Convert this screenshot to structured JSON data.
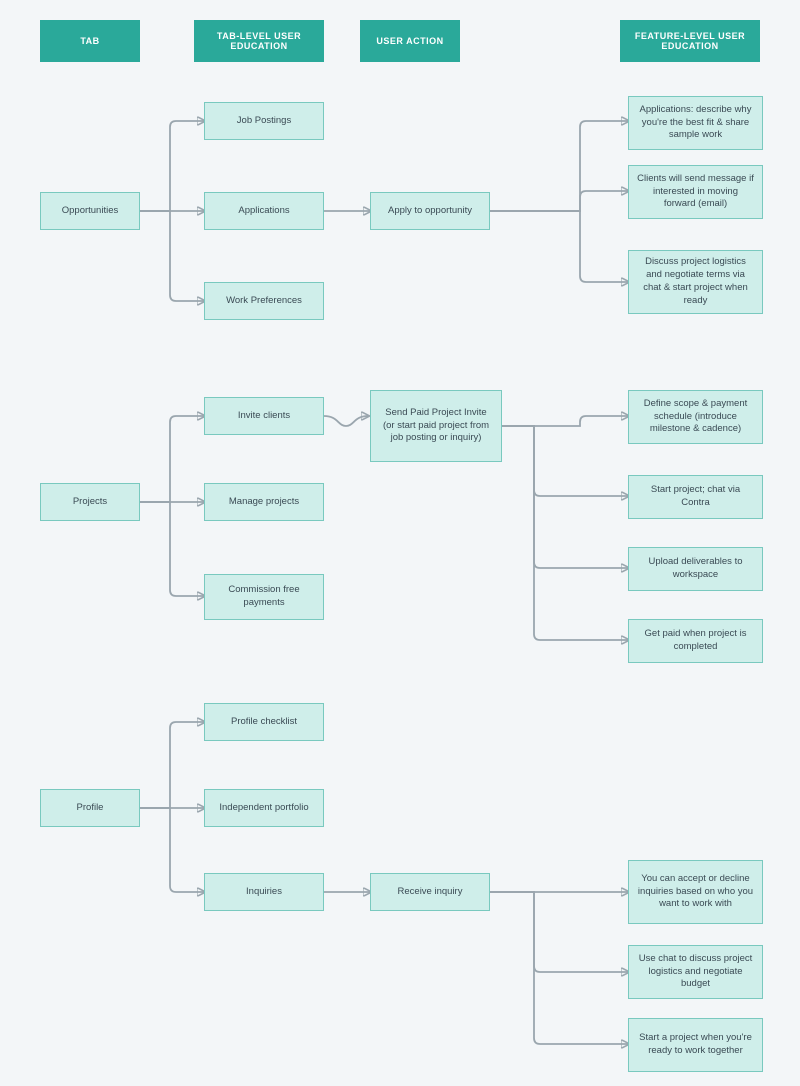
{
  "columns": {
    "tab": "TAB",
    "tabLevel": "TAB-LEVEL USER EDUCATION",
    "userAction": "USER ACTION",
    "featureLevel": "FEATURE-LEVEL USER EDUCATION"
  },
  "opportunities": {
    "tab": "Opportunities",
    "tabLevel": [
      "Job Postings",
      "Applications",
      "Work Preferences"
    ],
    "userAction": "Apply to opportunity",
    "featureLevel": [
      "Applications: describe why you're the best fit & share sample work",
      "Clients will send message if interested in moving forward (email)",
      "Discuss project logistics and negotiate terms via chat & start project when ready"
    ]
  },
  "projects": {
    "tab": "Projects",
    "tabLevel": [
      "Invite clients",
      "Manage projects",
      "Commission free payments"
    ],
    "userAction": "Send Paid Project Invite (or start paid project from job posting or inquiry)",
    "featureLevel": [
      "Define scope & payment schedule (introduce milestone & cadence)",
      "Start project; chat via Contra",
      "Upload deliverables to workspace",
      "Get paid when project is completed"
    ]
  },
  "profile": {
    "tab": "Profile",
    "tabLevel": [
      "Profile checklist",
      "Independent portfolio",
      "Inquiries"
    ],
    "userAction": "Receive inquiry",
    "featureLevel": [
      "You can accept or decline inquiries based on who you want to work with",
      "Use chat to discuss project logistics and negotiate budget",
      "Start a project when you're ready to work together"
    ]
  }
}
